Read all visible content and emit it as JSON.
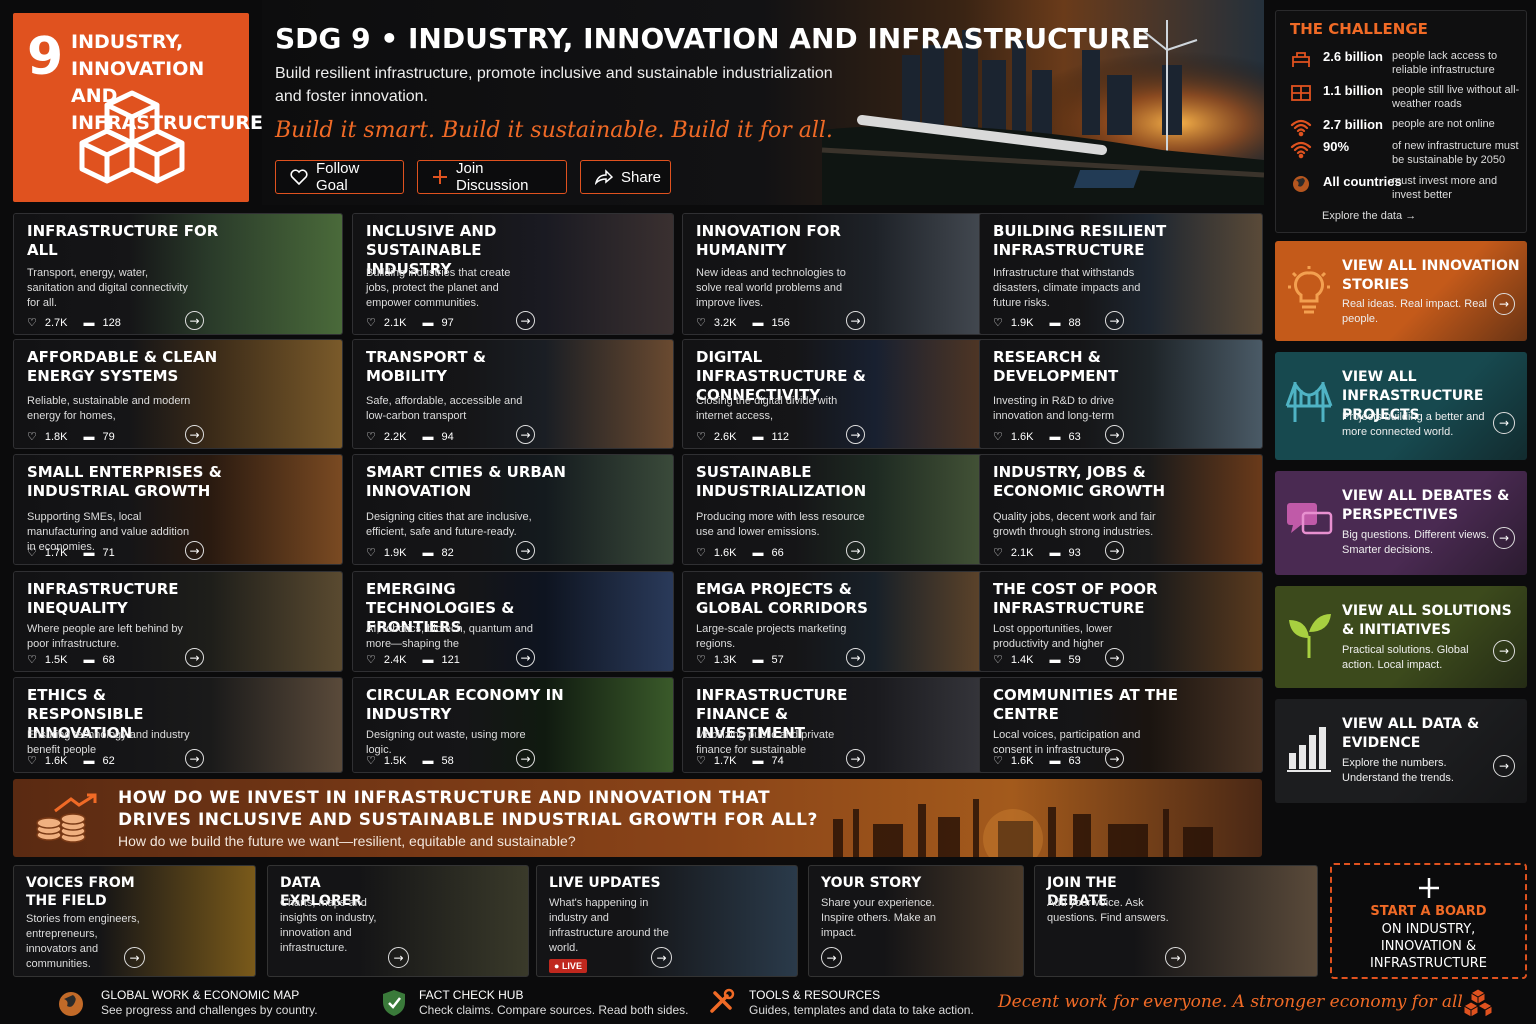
{
  "goal": {
    "number": "9",
    "logo_title": "INDUSTRY, INNOVATION AND INFRASTRUCTURE",
    "accent": "#e0521f"
  },
  "hero": {
    "title": "SDG 9 • INDUSTRY, INNOVATION AND INFRASTRUCTURE",
    "subtitle": "Build resilient infrastructure, promote inclusive and sustainable industrialization and foster innovation.",
    "tagline": "Build it smart. Build it sustainable. Build it for all.",
    "buttons": [
      {
        "label": "Follow Goal",
        "icon": "heart-icon"
      },
      {
        "label": "Join Discussion",
        "icon": "plus-icon"
      },
      {
        "label": "Share",
        "icon": "share-icon"
      }
    ]
  },
  "challenge": {
    "title": "THE CHALLENGE",
    "rows": [
      {
        "value": "2.6 billion",
        "desc": "people lack access to reliable infrastructure",
        "icon": "utility-icon"
      },
      {
        "value": "1.1 billion",
        "desc": "people still live without all-weather roads",
        "icon": "road-icon"
      },
      {
        "value": "2.7 billion",
        "desc": "people are not online",
        "icon": "wifi-icon"
      },
      {
        "value": "90%",
        "desc": "of new infrastructure must be sustainable by 2050",
        "icon": "wifi-icon"
      },
      {
        "value": "All countries",
        "desc": "must invest more and invest better",
        "icon": "globe-icon"
      }
    ],
    "explore": "Explore the data"
  },
  "cards": [
    {
      "title": "Infrastructure for all",
      "desc": "Transport, energy, water, sanitation and digital connectivity for all.",
      "likes": "2.7K",
      "comments": "128"
    },
    {
      "title": "Inclusive and sustainable industry",
      "desc": "Building industries that create jobs, protect the planet and empower communities.",
      "likes": "2.1K",
      "comments": "97"
    },
    {
      "title": "Innovation for humanity",
      "desc": "New ideas and technologies to solve real world problems and improve lives.",
      "likes": "3.2K",
      "comments": "156"
    },
    {
      "title": "Building resilient infrastructure",
      "desc": "Infrastructure that withstands disasters, climate impacts and future risks.",
      "likes": "1.9K",
      "comments": "88"
    },
    {
      "title": "Affordable & clean energy systems",
      "desc": "Reliable, sustainable and modern energy for homes,",
      "likes": "1.8K",
      "comments": "79"
    },
    {
      "title": "Transport & mobility",
      "desc": "Safe, affordable, accessible and low-carbon transport",
      "likes": "2.2K",
      "comments": "94"
    },
    {
      "title": "Digital infrastructure & connectivity",
      "desc": "Closing the digital divide with internet access,",
      "likes": "2.6K",
      "comments": "112"
    },
    {
      "title": "Research & development",
      "desc": "Investing in R&D to drive innovation and long-term",
      "likes": "1.6K",
      "comments": "63"
    },
    {
      "title": "Small enterprises & industrial growth",
      "desc": "Supporting SMEs, local manufacturing and value addition in economies.",
      "likes": "1.7K",
      "comments": "71"
    },
    {
      "title": "Smart cities & urban innovation",
      "desc": "Designing cities that are inclusive, efficient, safe and future-ready.",
      "likes": "1.9K",
      "comments": "82"
    },
    {
      "title": "Sustainable industrialization",
      "desc": "Producing more with less resource use and lower emissions.",
      "likes": "1.6K",
      "comments": "66"
    },
    {
      "title": "Industry, jobs & economic growth",
      "desc": "Quality jobs, decent work and fair growth through strong industries.",
      "likes": "2.1K",
      "comments": "93"
    },
    {
      "title": "Infrastructure inequality",
      "desc": "Where people are left behind by poor infrastructure.",
      "likes": "1.5K",
      "comments": "68"
    },
    {
      "title": "Emerging technologies & frontiers",
      "desc": "AI, robotics, biotech, quantum and more—shaping the",
      "likes": "2.4K",
      "comments": "121"
    },
    {
      "title": "EMGA projects & global corridors",
      "desc": "Large-scale projects marketing regions.",
      "likes": "1.3K",
      "comments": "57"
    },
    {
      "title": "The cost of poor infrastructure",
      "desc": "Lost opportunities, lower productivity and higher",
      "likes": "1.4K",
      "comments": "59"
    },
    {
      "title": "Ethics & responsible innovation",
      "desc": "Ensuring technology and industry benefit people",
      "likes": "1.6K",
      "comments": "62"
    },
    {
      "title": "Circular economy in industry",
      "desc": "Designing out waste, using more logic.",
      "likes": "1.5K",
      "comments": "58"
    },
    {
      "title": "Infrastructure finance & investment",
      "desc": "Mobilizing public and private finance for sustainable",
      "likes": "1.7K",
      "comments": "74"
    },
    {
      "title": "Communities at the centre",
      "desc": "Local voices, participation and consent in infrastructure",
      "likes": "1.6K",
      "comments": "63"
    }
  ],
  "side": [
    {
      "label": "VIEW ALL INNOVATION STORIES",
      "desc": "Real ideas. Real impact. Real people.",
      "icon": "lightbulb-icon",
      "color": "#c45a1a"
    },
    {
      "label": "VIEW ALL INFRASTRUCTURE PROJECTS",
      "desc": "Projects building a better and more connected world.",
      "icon": "bridge-icon",
      "color": "#17494f"
    },
    {
      "label": "VIEW ALL DEBATES & PERSPECTIVES",
      "desc": "Big questions. Different views. Smarter decisions.",
      "icon": "chat-icon",
      "color": "#4a2a52"
    },
    {
      "label": "VIEW ALL SOLUTIONS & INITIATIVES",
      "desc": "Practical solutions. Global action. Local impact.",
      "icon": "sprout-icon",
      "color": "#3c4a1c"
    },
    {
      "label": "VIEW ALL DATA & EVIDENCE",
      "desc": "Explore the numbers. Understand the trends.",
      "icon": "barchart-icon",
      "color": "#1c1d1f"
    }
  ],
  "banner": {
    "title": "HOW DO WE INVEST IN INFRASTRUCTURE AND INNOVATION THAT DRIVES INCLUSIVE AND SUSTAINABLE INDUSTRIAL GROWTH FOR ALL?",
    "subtitle": "How do we build the future we want—resilient, equitable and sustainable?"
  },
  "bottom": [
    {
      "title": "VOICES FROM THE FIELD",
      "desc": "Stories from engineers, entrepreneurs, innovators and communities."
    },
    {
      "title": "DATA EXPLORER",
      "desc": "Charts, maps and insights on industry, innovation and infrastructure."
    },
    {
      "title": "LIVE UPDATES",
      "desc": "What's happening in industry and infrastructure around the world.",
      "badge": "LIVE"
    },
    {
      "title": "YOUR STORY",
      "desc": "Share your experience. Inspire others. Make an impact."
    },
    {
      "title": "JOIN THE DEBATE",
      "desc": "Add your voice. Ask questions. Find answers."
    }
  ],
  "start_board": {
    "line1": "START A BOARD",
    "line2": "ON INDUSTRY, INNOVATION & INFRASTRUCTURE"
  },
  "footer": {
    "items": [
      {
        "title": "GLOBAL WORK & ECONOMIC MAP",
        "sub": "See progress and challenges by country.",
        "icon": "globe-icon"
      },
      {
        "title": "FACT CHECK HUB",
        "sub": "Check claims. Compare sources. Read both sides.",
        "icon": "shield-check-icon"
      },
      {
        "title": "TOOLS & RESOURCES",
        "sub": "Guides, templates and data to take action.",
        "icon": "tools-icon"
      }
    ],
    "tagline": "Decent work for everyone. A stronger economy for all."
  }
}
